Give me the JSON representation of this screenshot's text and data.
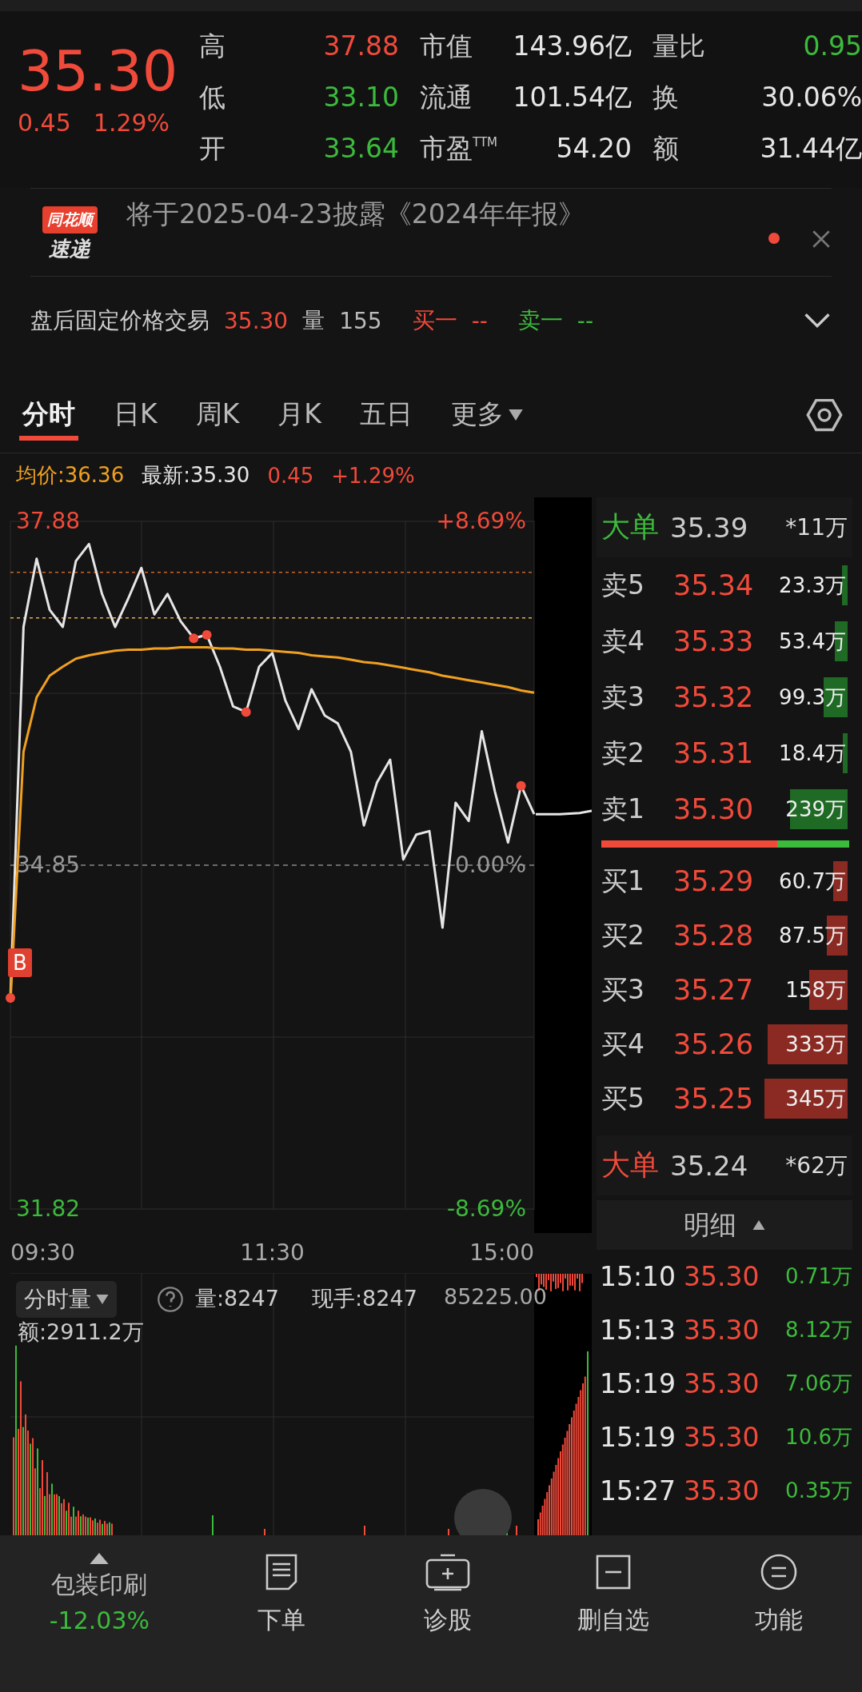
{
  "quote": {
    "price": "35.30",
    "change": "0.45",
    "change_pct": "1.29%",
    "stats": [
      {
        "label": "高",
        "value": "37.88",
        "color": "#f04a3a"
      },
      {
        "label": "市值",
        "value": "143.96亿",
        "color": "#e6e6e6"
      },
      {
        "label": "量比",
        "value": "0.95",
        "color": "#3cba3c"
      },
      {
        "label": "低",
        "value": "33.10",
        "color": "#3cba3c"
      },
      {
        "label": "流通",
        "value": "101.54亿",
        "color": "#e6e6e6"
      },
      {
        "label": "换",
        "value": "30.06%",
        "color": "#e6e6e6"
      },
      {
        "label": "开",
        "value": "33.64",
        "color": "#3cba3c"
      },
      {
        "label": "市盈$^{TTM}$",
        "value": "54.20",
        "color": "#e6e6e6"
      },
      {
        "label": "额",
        "value": "31.44亿",
        "color": "#e6e6e6"
      }
    ]
  },
  "notice": {
    "logo_top": "同花顺",
    "logo_bottom": "速递",
    "text": "将于2025-04-23披露《2024年年报》",
    "unread": true
  },
  "after_hours": {
    "label": "盘后固定价格交易",
    "price": "35.30",
    "volume_label": "量",
    "volume": "155",
    "bid_label": "买一",
    "bid": "--",
    "ask_label": "卖一",
    "ask": "--",
    "expanded": false
  },
  "tabs": [
    {
      "label": "分时",
      "selected": true,
      "kind": "plain"
    },
    {
      "label": "日K",
      "selected": false,
      "kind": "plain"
    },
    {
      "label": "周K",
      "selected": false,
      "kind": "plain"
    },
    {
      "label": "月K",
      "selected": false,
      "kind": "plain"
    },
    {
      "label": "五日",
      "selected": false,
      "kind": "plain"
    },
    {
      "label": "更多",
      "selected": false,
      "kind": "dropdown"
    }
  ],
  "info": {
    "avg": "均价:36.36",
    "latest": "最新:35.30",
    "change": "0.45",
    "change_pct": "+1.29%"
  },
  "price_chart": {
    "percent_labels": [
      "+8.69%",
      "0.00%",
      "-8.69%"
    ],
    "time_labels": [
      "09:30",
      "11:30",
      "15:00"
    ],
    "buy_marker": "B",
    "chart_data": {
      "type": "line",
      "ylim": [
        31.82,
        37.88
      ],
      "yticks": [
        37.88,
        34.85,
        31.82
      ],
      "series": [
        {
          "color": "#e6e6e6",
          "values": [
            33.68,
            36.95,
            37.55,
            37.1,
            36.95,
            37.53,
            37.68,
            37.24,
            36.95,
            37.2,
            37.47,
            37.06,
            37.24,
            37.0,
            36.85,
            36.88,
            36.6,
            36.25,
            36.2,
            36.6,
            36.72,
            36.3,
            36.05,
            36.4,
            36.17,
            36.1,
            35.85,
            35.2,
            35.58,
            35.78,
            34.9,
            35.12,
            35.15,
            34.3,
            35.4,
            35.24,
            36.03,
            35.5,
            35.05,
            35.55,
            35.3
          ]
        },
        {
          "color": "#f0a020",
          "values": [
            33.64,
            35.85,
            36.33,
            36.52,
            36.6,
            36.67,
            36.7,
            36.72,
            36.74,
            36.75,
            36.75,
            36.76,
            36.76,
            36.77,
            36.77,
            36.77,
            36.76,
            36.76,
            36.75,
            36.75,
            36.74,
            36.73,
            36.72,
            36.7,
            36.69,
            36.68,
            36.66,
            36.64,
            36.63,
            36.61,
            36.59,
            36.57,
            36.55,
            36.52,
            36.5,
            36.48,
            36.46,
            36.44,
            36.42,
            36.39,
            36.37
          ]
        }
      ],
      "ref_lines": [
        {
          "axis": "y",
          "value": 34.85
        },
        {
          "axis": "y",
          "value": 37.43
        },
        {
          "axis": "y",
          "value": 37.03
        }
      ]
    }
  },
  "order_book": {
    "big_top": {
      "label": "大单",
      "price": "35.39",
      "volume": "*11万",
      "color": "#3cba3c"
    },
    "asks": [
      {
        "label": "卖5",
        "price": "35.34",
        "volume": "23.3万"
      },
      {
        "label": "卖4",
        "price": "35.33",
        "volume": "53.4万"
      },
      {
        "label": "卖3",
        "price": "35.32",
        "volume": "99.3万"
      },
      {
        "label": "卖2",
        "price": "35.31",
        "volume": "18.4万"
      },
      {
        "label": "卖1",
        "price": "35.30",
        "volume": "239万"
      }
    ],
    "balance": {
      "level": 0.71
    },
    "bids": [
      {
        "label": "买1",
        "price": "35.29",
        "volume": "60.7万"
      },
      {
        "label": "买2",
        "price": "35.28",
        "volume": "87.5万"
      },
      {
        "label": "买3",
        "price": "35.27",
        "volume": "158万"
      },
      {
        "label": "买4",
        "price": "35.26",
        "volume": "333万"
      },
      {
        "label": "买5",
        "price": "35.25",
        "volume": "345万"
      }
    ],
    "big_bottom": {
      "label": "大单",
      "price": "35.24",
      "volume": "*62万",
      "color": "#f04a3a"
    }
  },
  "detail": {
    "title": "明细",
    "rows": [
      {
        "time": "15:10",
        "price": "35.30",
        "volume": "0.71万"
      },
      {
        "time": "15:13",
        "price": "35.30",
        "volume": "8.12万"
      },
      {
        "time": "15:19",
        "price": "35.30",
        "volume": "7.06万"
      },
      {
        "time": "15:19",
        "price": "35.30",
        "volume": "10.6万"
      },
      {
        "time": "15:27",
        "price": "35.30",
        "volume": "0.35万"
      }
    ]
  },
  "volume_panel": {
    "selector": "分时量",
    "volume": "量:8247",
    "current": "现手:8247",
    "max": "85225.00",
    "amount": "额:2911.2万"
  },
  "nav": {
    "sector": {
      "name": "包装印刷",
      "change": "-12.03%",
      "color": "#3cba3c"
    },
    "items": [
      {
        "label": "下单",
        "kind": "order"
      },
      {
        "label": "诊股",
        "kind": "diagnose"
      },
      {
        "label": "删自选",
        "kind": "remove"
      },
      {
        "label": "功能",
        "kind": "menu"
      }
    ]
  }
}
